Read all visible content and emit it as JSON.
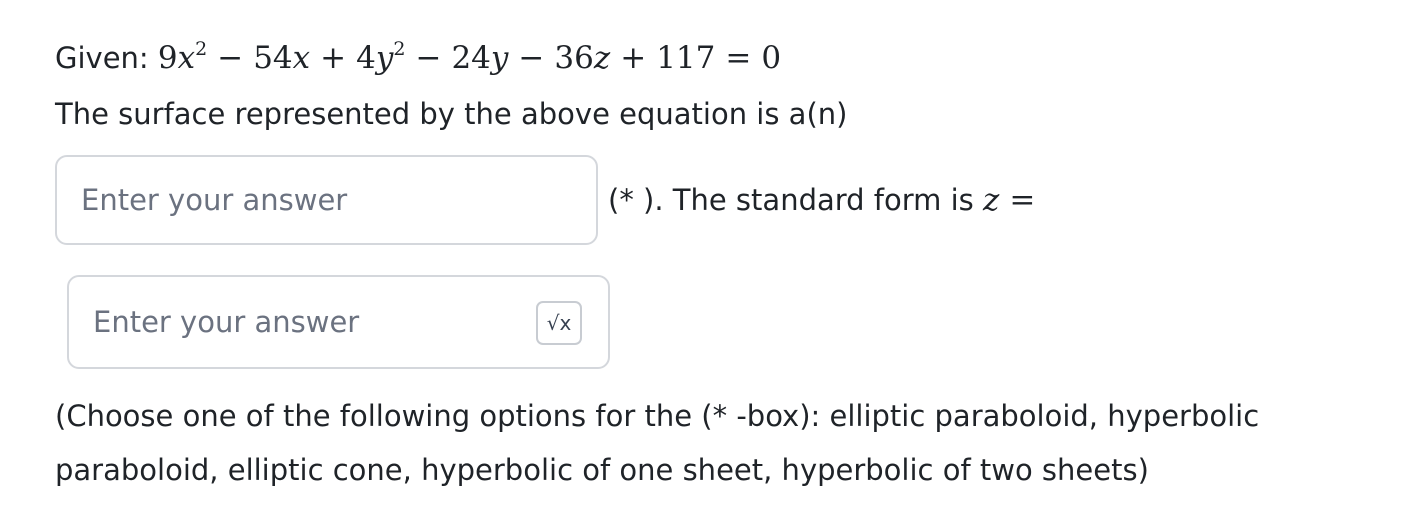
{
  "question": {
    "given_label": "Given:",
    "equation": {
      "t1_coef": "9",
      "t1_var": "x",
      "t1_exp": "2",
      "op1": "−",
      "t2": "54",
      "t2_var": "x",
      "op2": "+",
      "t3_coef": "4",
      "t3_var": "y",
      "t3_exp": "2",
      "op3": "−",
      "t4": "24",
      "t4_var": "y",
      "op4": "−",
      "t5": "36",
      "t5_var": "z",
      "op5": "+",
      "t6": "117",
      "eq": "=",
      "rhs": "0"
    },
    "prompt": "The surface represented by the above equation is a(n)",
    "after_box1_text": "(* ). The standard form is ",
    "z_var": "z",
    "z_eq": "=",
    "instructions": "(Choose one of the following options for the (* -box): elliptic paraboloid, hyperbolic paraboloid, elliptic cone, hyperbolic of one sheet, hyperbolic of two sheets)"
  },
  "inputs": {
    "surface_placeholder": "Enter your answer",
    "standard_form_placeholder": "Enter your answer",
    "math_button_label": "√x"
  }
}
